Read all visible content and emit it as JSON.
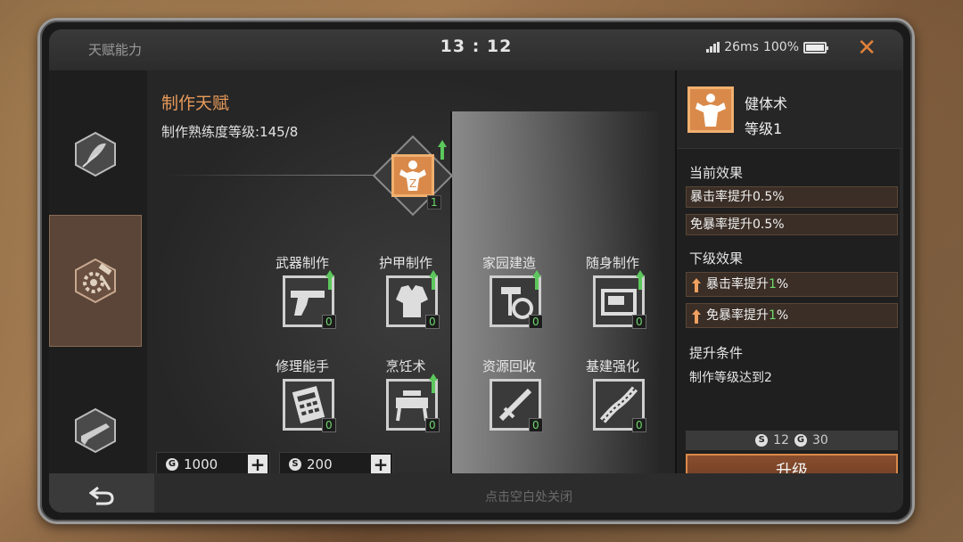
{
  "header": {
    "app_title": "天赋能力",
    "time": "13 : 12",
    "ping": "26ms",
    "battery": "100%"
  },
  "sidebar": {
    "tabs": [
      {
        "icon": "leaf-badge-icon",
        "active": false
      },
      {
        "icon": "gear-hammer-icon",
        "active": true
      },
      {
        "icon": "rifle-badge-icon",
        "active": false
      }
    ]
  },
  "main": {
    "title": "制作天赋",
    "proficiency": "制作熟练度等级:145/8",
    "main_skill_level": "1",
    "skills": [
      {
        "label": "武器制作",
        "count": "0",
        "upgradable": true,
        "icon": "pistol-icon"
      },
      {
        "label": "护甲制作",
        "count": "0",
        "upgradable": true,
        "icon": "vest-icon"
      },
      {
        "label": "家园建造",
        "count": "0",
        "upgradable": true,
        "icon": "build-tools-icon"
      },
      {
        "label": "随身制作",
        "count": "0",
        "upgradable": true,
        "icon": "crate-icon"
      },
      {
        "label": "修理能手",
        "count": "0",
        "upgradable": false,
        "icon": "calculator-icon"
      },
      {
        "label": "烹饪术",
        "count": "0",
        "upgradable": true,
        "icon": "stove-icon"
      },
      {
        "label": "资源回收",
        "count": "0",
        "upgradable": false,
        "icon": "recycle-tool-icon"
      },
      {
        "label": "基建强化",
        "count": "0",
        "upgradable": false,
        "icon": "road-icon"
      }
    ],
    "resources": {
      "gold": "1000",
      "silver": "200"
    }
  },
  "detail": {
    "name": "健体术",
    "level": "等级1",
    "current_title": "当前效果",
    "current_effects": [
      "暴击率提升0.5%",
      "免暴率提升0.5%"
    ],
    "next_title": "下级效果",
    "next_effects": [
      {
        "prefix": "暴击率提升",
        "value": "1",
        "suffix": "%"
      },
      {
        "prefix": "免暴率提升",
        "value": "1",
        "suffix": "%"
      }
    ],
    "condition_title": "提升条件",
    "condition": "制作等级达到2",
    "cost_silver": "12",
    "cost_gold": "30",
    "upgrade_label": "升级"
  },
  "footer": {
    "hint": "点击空白处关闭"
  },
  "colors": {
    "accent": "#e89a5a",
    "green": "#6dd86d",
    "upgrade_border": "#d98a4a"
  }
}
